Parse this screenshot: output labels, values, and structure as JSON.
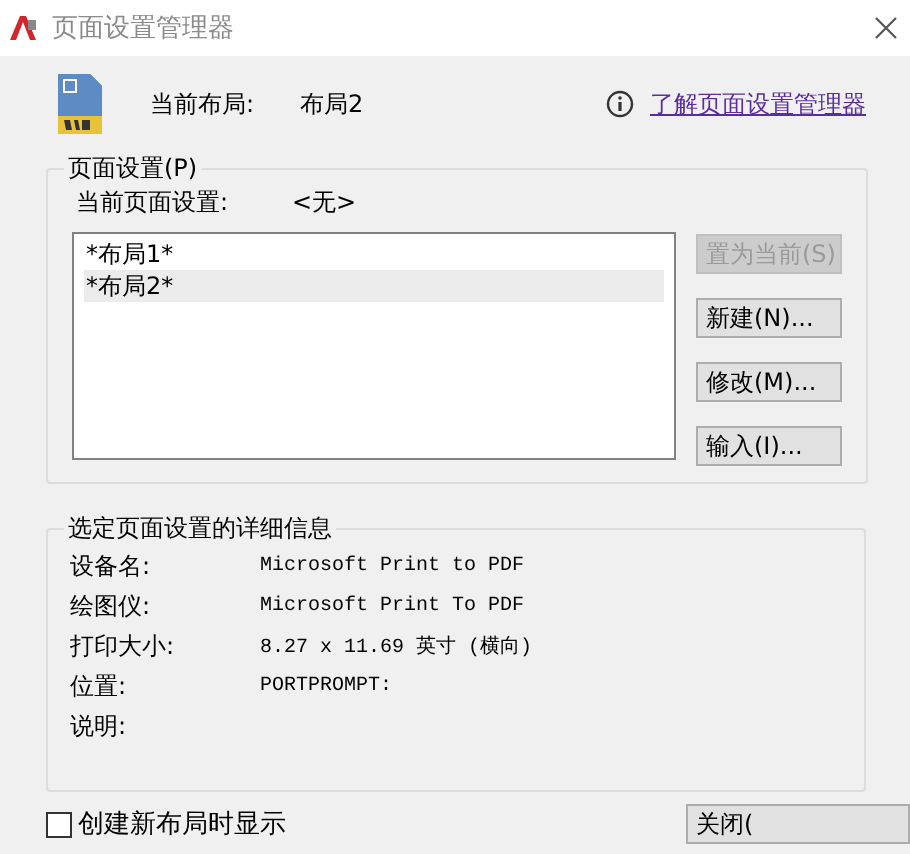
{
  "window": {
    "title": "页面设置管理器"
  },
  "current_layout": {
    "label": "当前布局:",
    "value": "布局2"
  },
  "help_link": {
    "label": "了解页面设置管理器"
  },
  "page_setups": {
    "title": "页面设置(P)",
    "current_label": "当前页面设置:",
    "current_value": "<无>",
    "items": [
      {
        "label": "*布局1*",
        "selected": false
      },
      {
        "label": "*布局2*",
        "selected": true
      }
    ],
    "buttons": [
      {
        "label": "置为当前(S)",
        "disabled": true
      },
      {
        "label": "新建(N)...",
        "disabled": false
      },
      {
        "label": "修改(M)...",
        "disabled": false
      },
      {
        "label": "输入(I)...",
        "disabled": false
      }
    ]
  },
  "details": {
    "title": "选定页面设置的详细信息",
    "rows": [
      {
        "label": "设备名:",
        "value": "Microsoft Print to PDF"
      },
      {
        "label": "绘图仪:",
        "value": "Microsoft Print To PDF"
      },
      {
        "label": "打印大小:",
        "value": "8.27 x 11.69 英寸 (横向)"
      },
      {
        "label": "位置:",
        "value": "PORTPROMPT:"
      },
      {
        "label": "说明:"
      }
    ]
  },
  "show_on_new_layout": {
    "label": "创建新布局时显示",
    "checked": false
  },
  "close_button": {
    "label": "关闭("
  }
}
